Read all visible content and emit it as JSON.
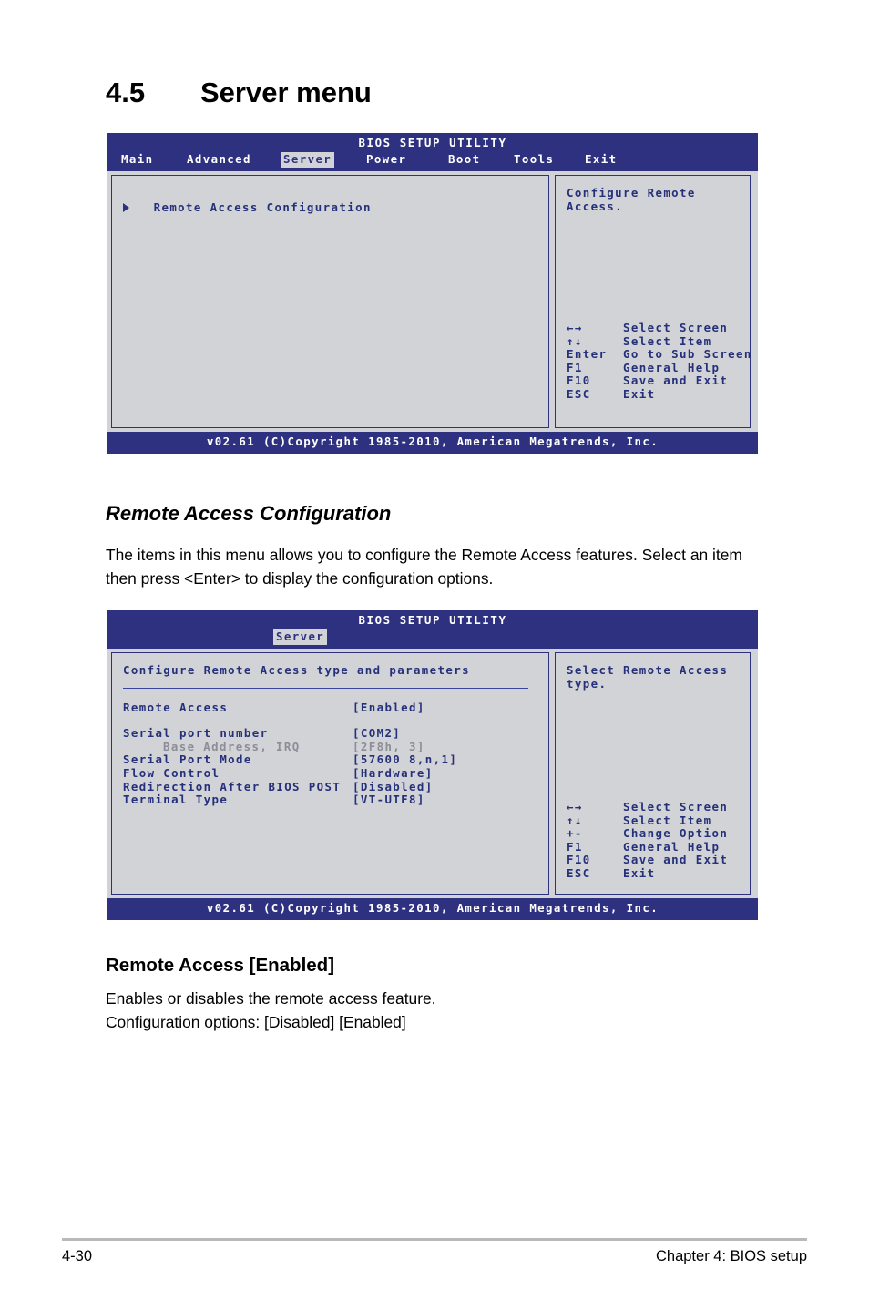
{
  "section": {
    "number": "4.5",
    "title": "Server menu"
  },
  "bios_screen_1": {
    "utility_title": "BIOS SETUP UTILITY",
    "tabs": [
      {
        "label": "Main",
        "active": false
      },
      {
        "label": "Advanced",
        "active": false
      },
      {
        "label": "Server",
        "active": true
      },
      {
        "label": "Power",
        "active": false
      },
      {
        "label": "Boot",
        "active": false
      },
      {
        "label": "Tools",
        "active": false
      },
      {
        "label": "Exit",
        "active": false
      }
    ],
    "menu_items": [
      {
        "label": "Remote Access Configuration",
        "submenu": true
      }
    ],
    "help_text": "Configure Remote\nAccess.",
    "key_legend": [
      {
        "key": "←→",
        "action": "Select Screen"
      },
      {
        "key": "↑↓",
        "action": "Select Item"
      },
      {
        "key": "Enter",
        "action": "Go to Sub Screen"
      },
      {
        "key": "F1",
        "action": "General Help"
      },
      {
        "key": "F10",
        "action": "Save and Exit"
      },
      {
        "key": "ESC",
        "action": "Exit"
      }
    ],
    "footer": "v02.61 (C)Copyright 1985-2010, American Megatrends, Inc."
  },
  "subheading_1": "Remote Access Configuration",
  "paragraph_1": "The items in this menu allows you to configure the Remote Access features. Select an item then press <Enter> to display the configuration options.",
  "bios_screen_2": {
    "utility_title": "BIOS SETUP UTILITY",
    "tabs": [
      {
        "label": "Server",
        "active": true
      }
    ],
    "pane_title": "Configure Remote Access type and parameters",
    "settings": [
      {
        "label": "Remote Access",
        "value": "[Enabled]",
        "dim": false,
        "indent": 0
      },
      {
        "label": "Serial port number",
        "value": "[COM2]",
        "dim": false,
        "indent": 0
      },
      {
        "label": "Base Address, IRQ",
        "value": "[2F8h, 3]",
        "dim": true,
        "indent": 1
      },
      {
        "label": "Serial Port Mode",
        "value": "[57600 8,n,1]",
        "dim": false,
        "indent": 0
      },
      {
        "label": "Flow Control",
        "value": "[Hardware]",
        "dim": false,
        "indent": 0
      },
      {
        "label": "Redirection After BIOS POST",
        "value": "[Disabled]",
        "dim": false,
        "indent": 0
      },
      {
        "label": "Terminal Type",
        "value": "[VT-UTF8]",
        "dim": false,
        "indent": 0
      }
    ],
    "help_text": "Select Remote Access\ntype.",
    "key_legend": [
      {
        "key": "←→",
        "action": "Select Screen"
      },
      {
        "key": "↑↓",
        "action": "Select Item"
      },
      {
        "key": "+-",
        "action": "Change Option"
      },
      {
        "key": "F1",
        "action": "General Help"
      },
      {
        "key": "F10",
        "action": "Save and Exit"
      },
      {
        "key": "ESC",
        "action": "Exit"
      }
    ],
    "footer": "v02.61 (C)Copyright 1985-2010, American Megatrends, Inc."
  },
  "subheading_2": "Remote Access [Enabled]",
  "paragraph_2_line1": "Enables or disables the remote access feature.",
  "paragraph_2_line2": "Configuration options: [Disabled] [Enabled]",
  "page_footer": {
    "left": "4-30",
    "right": "Chapter 4: BIOS setup"
  },
  "colors": {
    "bios_blue": "#2e3180",
    "bios_grey": "#d2d3d7",
    "text_blue": "#25307a",
    "dim_text": "#8b8d97"
  }
}
